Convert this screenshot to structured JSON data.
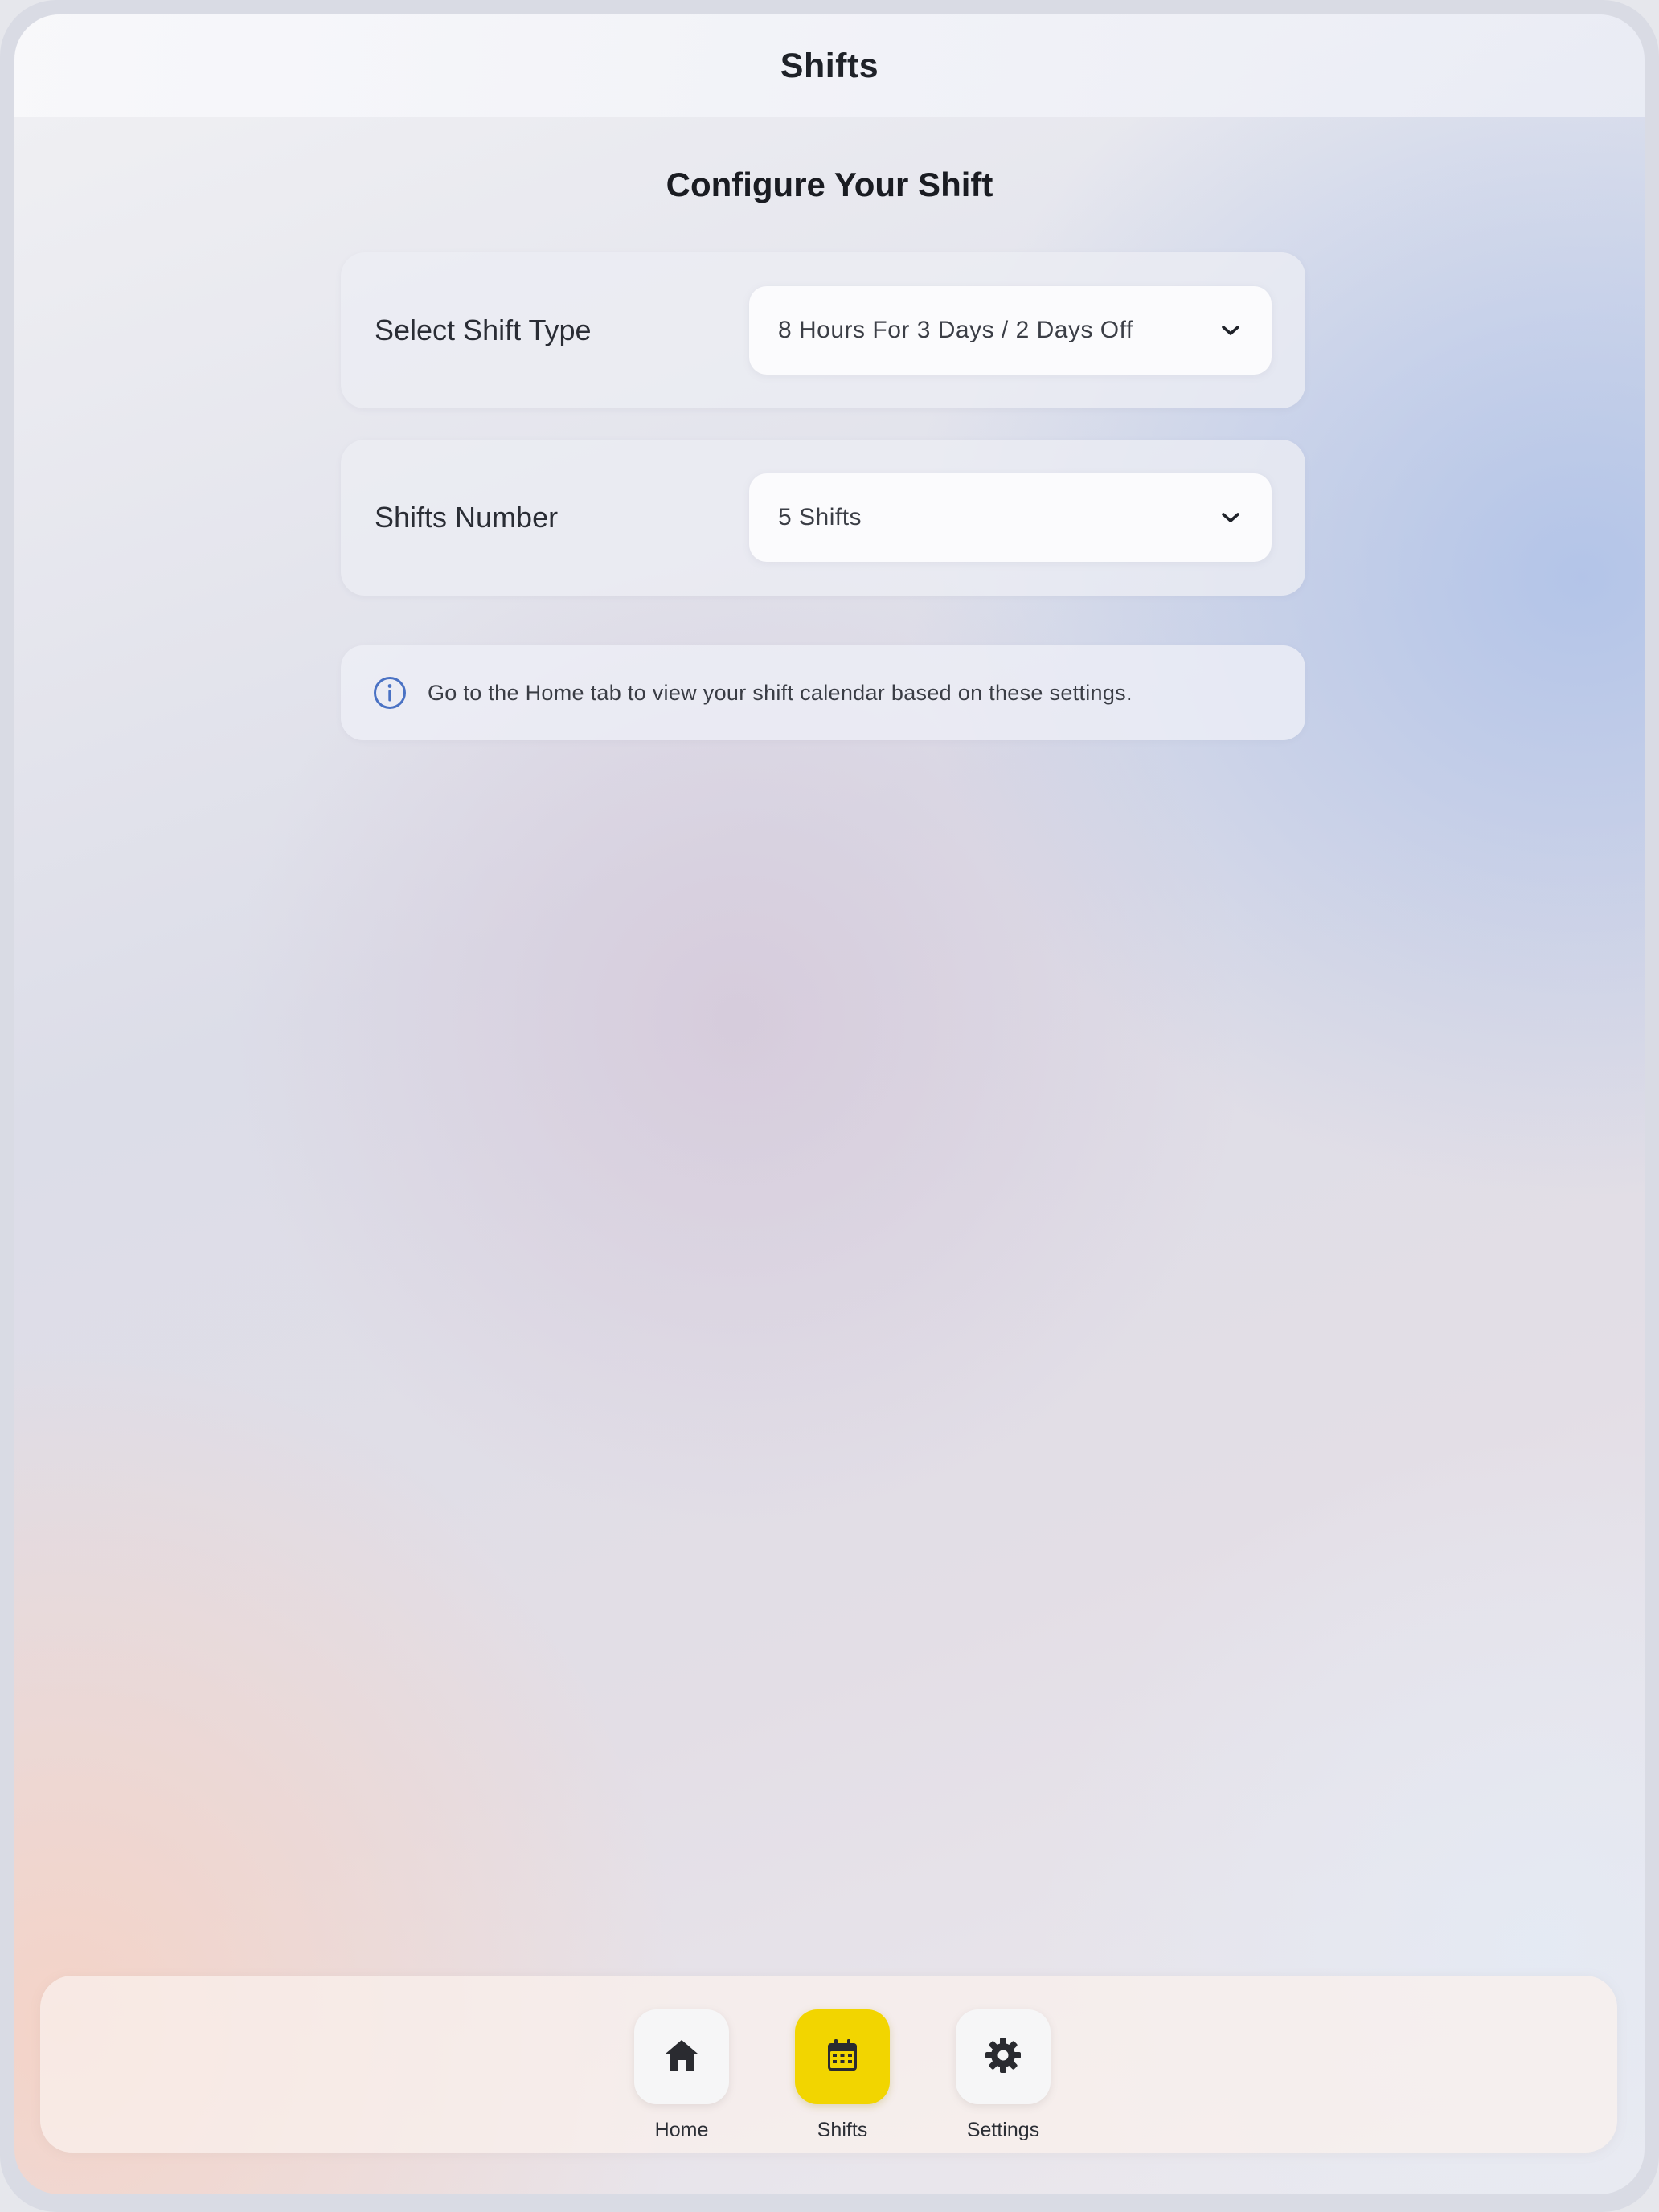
{
  "header": {
    "title": "Shifts"
  },
  "main": {
    "title": "Configure Your Shift",
    "settings": [
      {
        "label": "Select Shift Type",
        "value": "8 Hours For 3 Days / 2 Days Off",
        "icon": "chevron-down-icon"
      },
      {
        "label": "Shifts Number",
        "value": "5 Shifts",
        "icon": "chevron-down-icon"
      }
    ],
    "info": {
      "icon": "info-icon",
      "text": "Go to the Home tab to view your shift calendar based on these settings."
    }
  },
  "tabbar": {
    "active": "Shifts",
    "accent_color": "#f2d500",
    "tabs": [
      {
        "label": "Home",
        "icon": "home-icon"
      },
      {
        "label": "Shifts",
        "icon": "calendar-icon"
      },
      {
        "label": "Settings",
        "icon": "gear-icon"
      }
    ]
  }
}
